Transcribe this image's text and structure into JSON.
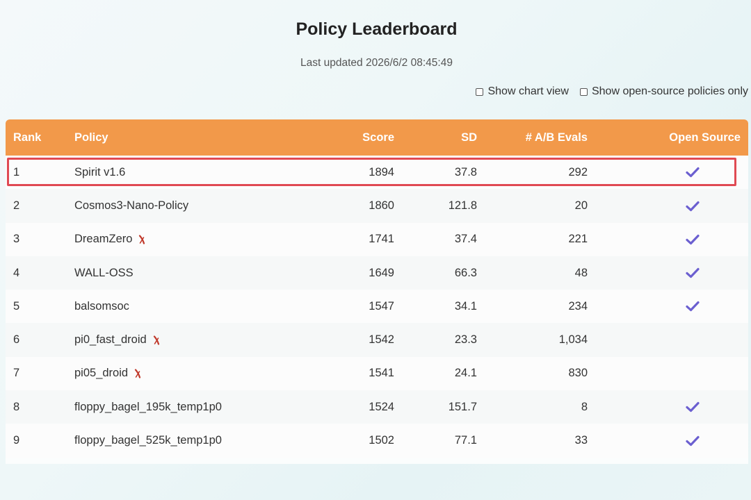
{
  "header": {
    "title": "Policy Leaderboard",
    "last_updated": "Last updated 2026/6/2 08:45:49"
  },
  "toggles": {
    "chart_view": "Show chart view",
    "open_source_only": "Show open-source policies only"
  },
  "table": {
    "columns": {
      "rank": "Rank",
      "policy": "Policy",
      "score": "Score",
      "sd": "SD",
      "evals": "# A/B Evals",
      "open_source": "Open Source"
    },
    "rows": [
      {
        "rank": "1",
        "policy": "Spirit v1.6",
        "score": "1894",
        "sd": "37.8",
        "evals": "292",
        "open_source": true,
        "closed_marker": false,
        "highlighted": true
      },
      {
        "rank": "2",
        "policy": "Cosmos3-Nano-Policy",
        "score": "1860",
        "sd": "121.8",
        "evals": "20",
        "open_source": true,
        "closed_marker": false
      },
      {
        "rank": "3",
        "policy": "DreamZero",
        "score": "1741",
        "sd": "37.4",
        "evals": "221",
        "open_source": true,
        "closed_marker": true
      },
      {
        "rank": "4",
        "policy": "WALL-OSS",
        "score": "1649",
        "sd": "66.3",
        "evals": "48",
        "open_source": true,
        "closed_marker": false
      },
      {
        "rank": "5",
        "policy": "balsomsoc",
        "score": "1547",
        "sd": "34.1",
        "evals": "234",
        "open_source": true,
        "closed_marker": false
      },
      {
        "rank": "6",
        "policy": "pi0_fast_droid",
        "score": "1542",
        "sd": "23.3",
        "evals": "1,034",
        "open_source": false,
        "closed_marker": true
      },
      {
        "rank": "7",
        "policy": "pi05_droid",
        "score": "1541",
        "sd": "24.1",
        "evals": "830",
        "open_source": false,
        "closed_marker": true
      },
      {
        "rank": "8",
        "policy": "floppy_bagel_195k_temp1p0",
        "score": "1524",
        "sd": "151.7",
        "evals": "8",
        "open_source": true,
        "closed_marker": false
      },
      {
        "rank": "9",
        "policy": "floppy_bagel_525k_temp1p0",
        "score": "1502",
        "sd": "77.1",
        "evals": "33",
        "open_source": true,
        "closed_marker": false
      }
    ]
  },
  "icons": {
    "check": "check-icon",
    "closed_marker": "x-mark-icon"
  },
  "colors": {
    "header_bg": "#f2994a",
    "check": "#6b5fd0",
    "highlight_border": "#e04a53",
    "closed_marker": "#c0392b"
  }
}
